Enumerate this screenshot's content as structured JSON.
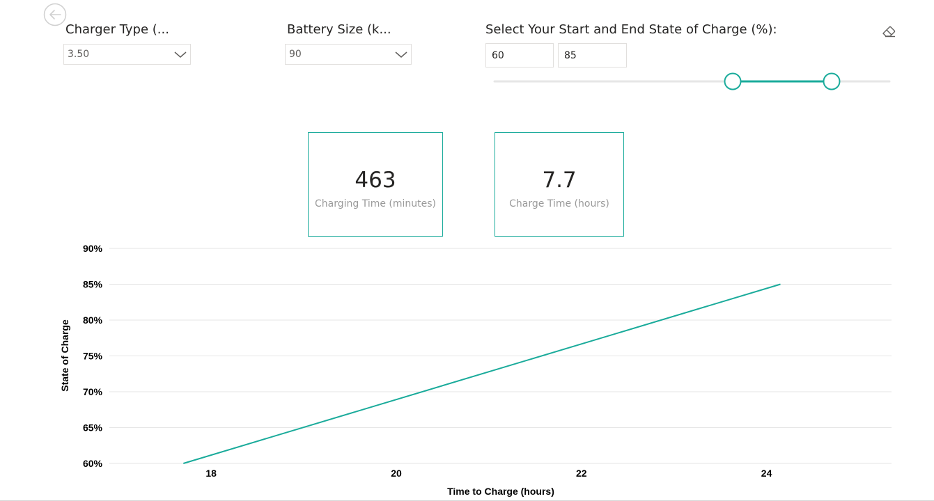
{
  "back": {
    "icon": "back-arrow-icon"
  },
  "slicers": {
    "charger_type": {
      "title": "Charger Type (...",
      "value": "3.50"
    },
    "battery_size": {
      "title": "Battery Size (k...",
      "value": "90"
    },
    "soc_range": {
      "title": "Select Your Start and End State of Charge (%):",
      "start": "60",
      "end": "85",
      "min": 0,
      "max": 100,
      "clear_icon": "eraser-icon"
    }
  },
  "cards": [
    {
      "value": "463",
      "label": "Charging Time (minutes)"
    },
    {
      "value": "7.7",
      "label": "Charge Time (hours)"
    }
  ],
  "colors": {
    "accent": "#1aab9b",
    "gridline": "#e6e6e6",
    "border": "#e1dfdd"
  },
  "chart_data": {
    "type": "line",
    "xlabel": "Time to Charge (hours)",
    "ylabel": "State of Charge",
    "xlim": [
      16.9,
      25.35
    ],
    "ylim": [
      60,
      90
    ],
    "x_ticks": [
      18,
      20,
      22,
      24
    ],
    "y_ticks": [
      60,
      65,
      70,
      75,
      80,
      85,
      90
    ],
    "y_tick_labels": [
      "60%",
      "65%",
      "70%",
      "75%",
      "80%",
      "85%",
      "90%"
    ],
    "grid": true,
    "series": [
      {
        "points": [
          [
            17.7,
            60
          ],
          [
            24.15,
            85
          ]
        ],
        "color": "#1aab9b"
      }
    ]
  }
}
